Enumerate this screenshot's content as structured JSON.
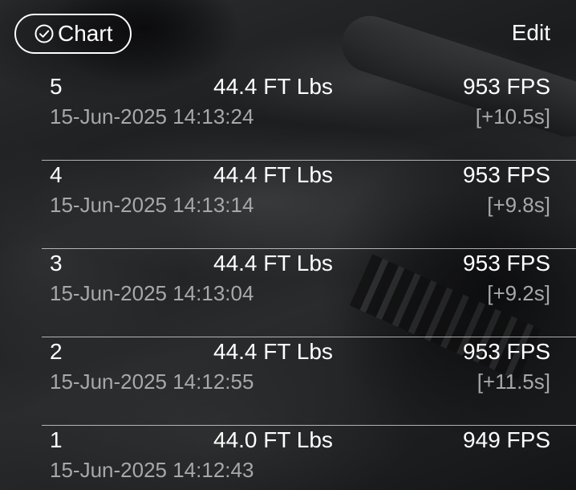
{
  "header": {
    "chart_label": "Chart",
    "chart_icon": "checkmark-circle-icon",
    "edit_label": "Edit"
  },
  "shots": [
    {
      "number": "5",
      "energy": "44.4 FT Lbs",
      "velocity": "953 FPS",
      "timestamp": "15-Jun-2025 14:13:24",
      "interval": "[+10.5s]"
    },
    {
      "number": "4",
      "energy": "44.4 FT Lbs",
      "velocity": "953 FPS",
      "timestamp": "15-Jun-2025 14:13:14",
      "interval": "[+9.8s]"
    },
    {
      "number": "3",
      "energy": "44.4 FT Lbs",
      "velocity": "953 FPS",
      "timestamp": "15-Jun-2025 14:13:04",
      "interval": "[+9.2s]"
    },
    {
      "number": "2",
      "energy": "44.4 FT Lbs",
      "velocity": "953 FPS",
      "timestamp": "15-Jun-2025 14:12:55",
      "interval": "[+11.5s]"
    },
    {
      "number": "1",
      "energy": "44.0 FT Lbs",
      "velocity": "949 FPS",
      "timestamp": "15-Jun-2025 14:12:43",
      "interval": ""
    }
  ],
  "colors": {
    "primary_text": "#ffffff",
    "secondary_text": "#a6a8aa"
  }
}
